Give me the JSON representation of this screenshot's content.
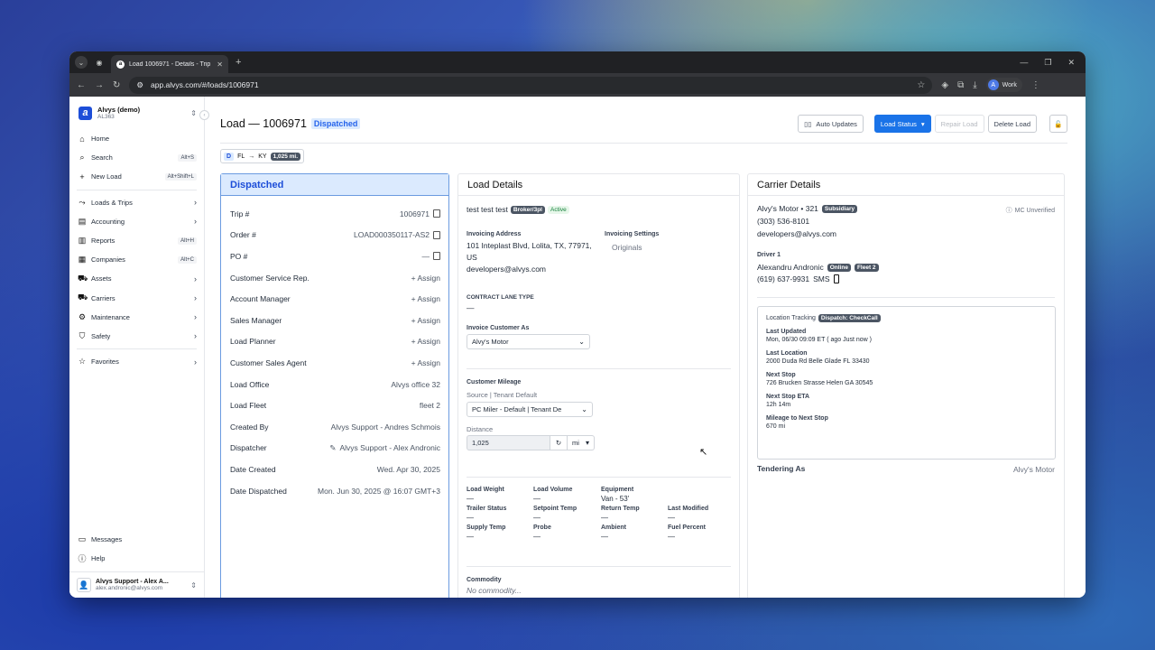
{
  "browser": {
    "tab_title": "Load 1006971 - Details - Trip #",
    "url": "app.alvys.com/#/loads/1006971",
    "profile_initial": "A",
    "profile_label": "Work"
  },
  "sidebar": {
    "org_name": "Alvys (demo)",
    "org_code": "AL363",
    "items": [
      {
        "label": "Home",
        "icon": "home-icon",
        "shortcut": ""
      },
      {
        "label": "Search",
        "icon": "search-icon",
        "shortcut": "Alt+S"
      },
      {
        "label": "New Load",
        "icon": "plus-icon",
        "shortcut": "Alt+Shift+L"
      },
      {
        "label": "Loads & Trips",
        "icon": "route-icon"
      },
      {
        "label": "Accounting",
        "icon": "accounting-icon"
      },
      {
        "label": "Reports",
        "icon": "reports-icon",
        "shortcut": "Alt+H"
      },
      {
        "label": "Companies",
        "icon": "companies-icon",
        "shortcut": "Alt+C"
      },
      {
        "label": "Assets",
        "icon": "truck-icon"
      },
      {
        "label": "Carriers",
        "icon": "carriers-icon"
      },
      {
        "label": "Maintenance",
        "icon": "wrench-icon"
      },
      {
        "label": "Safety",
        "icon": "shield-icon"
      },
      {
        "label": "Favorites",
        "icon": "star-icon"
      }
    ],
    "messages": "Messages",
    "help": "Help",
    "user_name": "Alvys Support - Alex A...",
    "user_email": "alex.andronic@alvys.com"
  },
  "header": {
    "title": "Load — 1006971",
    "status": "Dispatched",
    "auto_updates": "Auto Updates",
    "load_status": "Load Status",
    "repair_load": "Repair Load",
    "delete_load": "Delete Load"
  },
  "route": {
    "mode": "D",
    "origin": "FL",
    "arrow": "→",
    "destination": "KY",
    "miles": "1,025 mi."
  },
  "status_card": {
    "title": "Dispatched",
    "rows": [
      {
        "label": "Trip #",
        "value": "1006971",
        "kind": "copy"
      },
      {
        "label": "Order #",
        "value": "LOAD000350117-AS2",
        "kind": "copy"
      },
      {
        "label": "PO #",
        "value": "—",
        "kind": "copy"
      },
      {
        "label": "Customer Service Rep.",
        "value": "+ Assign",
        "kind": "assign"
      },
      {
        "label": "Account Manager",
        "value": "+ Assign",
        "kind": "assign"
      },
      {
        "label": "Sales Manager",
        "value": "+ Assign",
        "kind": "assign"
      },
      {
        "label": "Load Planner",
        "value": "+ Assign",
        "kind": "assign"
      },
      {
        "label": "Customer Sales Agent",
        "value": "+ Assign",
        "kind": "assign"
      },
      {
        "label": "Load Office",
        "value": "Alvys office 32",
        "kind": "text"
      },
      {
        "label": "Load Fleet",
        "value": "fleet 2",
        "kind": "text"
      },
      {
        "label": "Created By",
        "value": "Alvys Support - Andres Schmois",
        "kind": "text"
      },
      {
        "label": "Dispatcher",
        "value": "Alvys Support - Alex Andronic",
        "kind": "edit"
      },
      {
        "label": "Date Created",
        "value": "Wed. Apr 30, 2025",
        "kind": "text"
      },
      {
        "label": "Date Dispatched",
        "value": "Mon. Jun 30, 2025 @ 16:07 GMT+3",
        "kind": "text"
      }
    ]
  },
  "load_details": {
    "title": "Load Details",
    "customer": "test test test",
    "customer_type": "Broker/3pl",
    "customer_status": "Active",
    "invoicing_address_label": "Invoicing Address",
    "invoicing_address": "101 Inteplast Blvd, Lolita, TX, 77971, US",
    "invoicing_email": "developers@alvys.com",
    "invoicing_settings_label": "Invoicing Settings",
    "invoicing_settings_value": "Originals",
    "contract_lane_label": "CONTRACT LANE TYPE",
    "contract_lane_value": "—",
    "invoice_customer_as_label": "Invoice Customer As",
    "invoice_customer_as_value": "Alvy's Motor",
    "customer_mileage_label": "Customer Mileage",
    "mileage_source_label": "Source | Tenant Default",
    "mileage_source_value": "PC Miler - Default | Tenant De",
    "distance_label": "Distance",
    "distance_value": "1,025",
    "distance_unit": "mi",
    "specs": [
      {
        "label": "Load Weight",
        "value": "—"
      },
      {
        "label": "Load Volume",
        "value": "—"
      },
      {
        "label": "Equipment",
        "value": "Van  -  53'"
      },
      {
        "label": "",
        "value": ""
      },
      {
        "label": "Trailer Status",
        "value": "—"
      },
      {
        "label": "Setpoint Temp",
        "value": "—"
      },
      {
        "label": "Return Temp",
        "value": "—"
      },
      {
        "label": "Last Modified",
        "value": "—"
      },
      {
        "label": "Supply Temp",
        "value": "—"
      },
      {
        "label": "Probe",
        "value": "—"
      },
      {
        "label": "Ambient",
        "value": "—"
      },
      {
        "label": "Fuel Percent",
        "value": "—"
      }
    ],
    "commodity_label": "Commodity",
    "commodity_value": "No commodity..."
  },
  "carrier": {
    "title": "Carrier Details",
    "name": "Alvy's Motor • 321",
    "badge": "Subsidiary",
    "mc_status": "MC Unverified",
    "phone": "(303) 536-8101",
    "email": "developers@alvys.com",
    "driver_label": "Driver 1",
    "driver_name": "Alexandru Andronic",
    "driver_status": "Online",
    "driver_fleet": "Fleet 2",
    "driver_phone": "(619) 637-9931",
    "sms": "SMS",
    "tracking_label": "Location Tracking",
    "tracking_badge": "Dispatch: CheckCall",
    "last_updated_label": "Last Updated",
    "last_updated_value": "Mon, 06/30 09:09 ET ( ago Just now )",
    "last_location_label": "Last Location",
    "last_location_value": "2000 Duda Rd Belle Glade FL 33430",
    "next_stop_label": "Next Stop",
    "next_stop_value": "726 Brucken Strasse Helen GA 30545",
    "eta_label": "Next Stop ETA",
    "eta_value": "12h 14m",
    "mileage_label": "Mileage to Next Stop",
    "mileage_value": "670 mi",
    "tendering_label": "Tendering As",
    "tendering_value": "Alvy's Motor"
  }
}
